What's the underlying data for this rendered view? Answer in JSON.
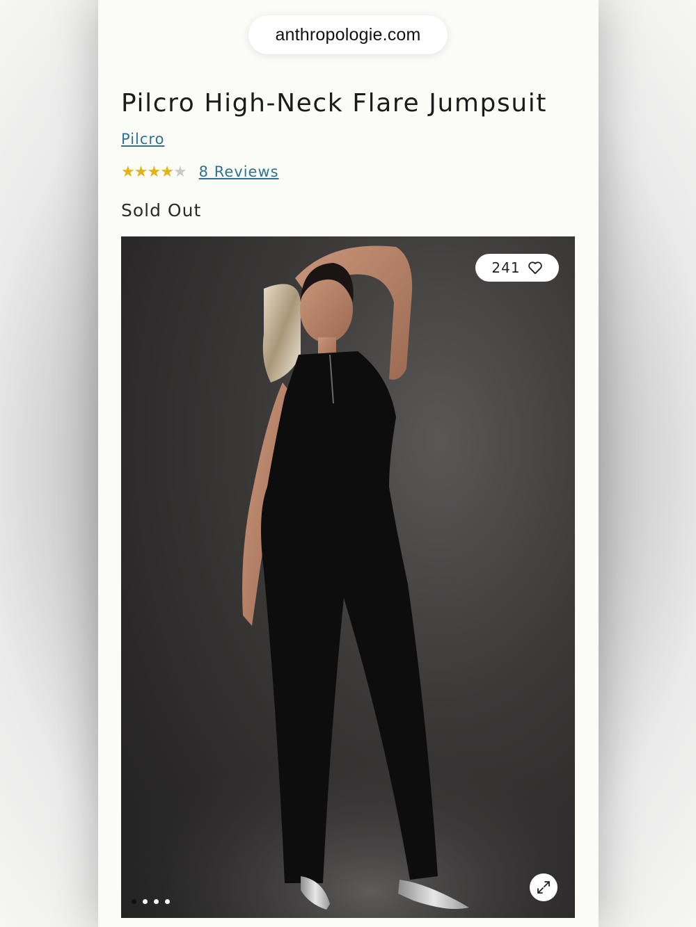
{
  "browser": {
    "url": "anthropologie.com"
  },
  "product": {
    "title": "Pilcro High-Neck Flare Jumpsuit",
    "brand": "Pilcro",
    "rating": 4,
    "rating_max": 5,
    "reviews_label": "8 Reviews",
    "stock_status": "Sold Out"
  },
  "gallery": {
    "favorites_count": "241",
    "icons": {
      "favorite": "heart-icon",
      "expand": "expand-icon"
    },
    "image_count": 4,
    "active_index": 0
  },
  "colors": {
    "link": "#2d7391",
    "star": "#e2b317",
    "star_empty": "#c9c9c9"
  }
}
